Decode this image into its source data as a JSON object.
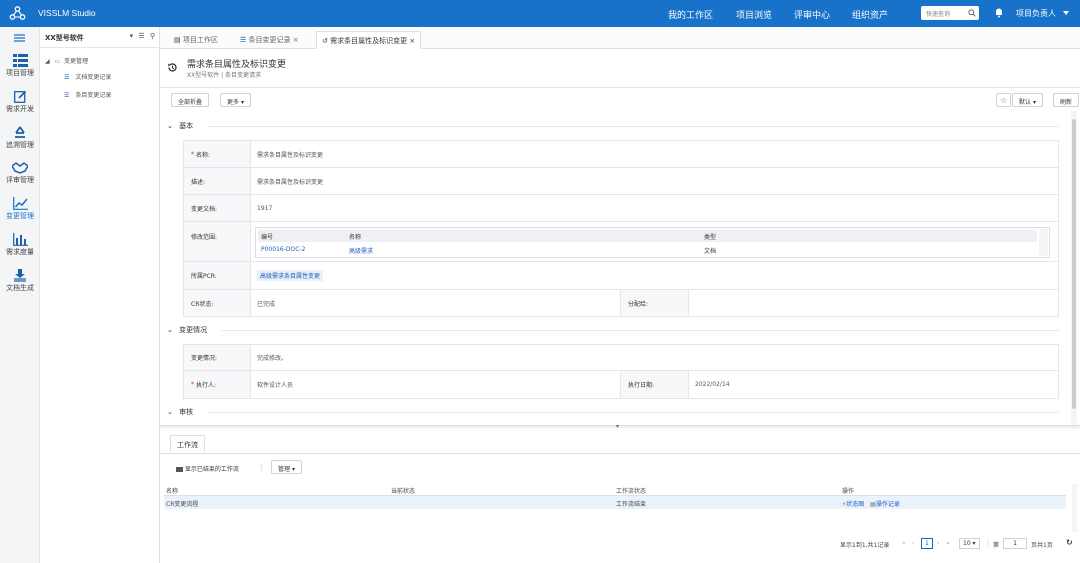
{
  "topbar": {
    "app_title": "VISSLM Studio",
    "nav": [
      "我的工作区",
      "项目浏览",
      "评审中心",
      "组织资产"
    ],
    "search_placeholder": "快速查询",
    "user": "项目负责人"
  },
  "leftbar": {
    "items": [
      {
        "label": "项目管理",
        "icon": "grid-list-icon"
      },
      {
        "label": "需求开发",
        "icon": "edit-icon"
      },
      {
        "label": "追溯管理",
        "icon": "recycle-icon"
      },
      {
        "label": "评审管理",
        "icon": "handshake-icon"
      },
      {
        "label": "变更管理",
        "icon": "trend-chart-icon"
      },
      {
        "label": "需求度量",
        "icon": "bar-chart-icon"
      },
      {
        "label": "文档生成",
        "icon": "document-stack-icon"
      }
    ]
  },
  "tree": {
    "title": "XX型号软件",
    "root": "变更管理",
    "children": [
      "文档变更记录",
      "条目变更记录"
    ]
  },
  "tabs": [
    {
      "label": "项目工作区",
      "icon": "document-icon"
    },
    {
      "label": "条目变更记录",
      "icon": "list-icon"
    },
    {
      "label": "需求条目属性及标识变更",
      "icon": "history-icon"
    }
  ],
  "page": {
    "title": "需求条目属性及标识变更",
    "crumb": "XX型号软件 | 条目变更请求"
  },
  "toolbar": {
    "collapse_all": "全部折叠",
    "more": "更多",
    "default": "默认",
    "refresh": "刷新"
  },
  "sections": {
    "basic": "基本",
    "change": "变更情况",
    "review": "审核"
  },
  "form": {
    "name_label": "名称:",
    "name_value": "需求条目属性及标识变更",
    "desc_label": "描述:",
    "desc_value": "需求条目属性及标识变更",
    "doc_label": "变更文档:",
    "doc_value": "1917",
    "scope_label": "修改范围:",
    "scope_headers": [
      "编号",
      "名称",
      "类型"
    ],
    "scope_row": [
      "P00016-DOC-2",
      "高级需求",
      "文档"
    ],
    "pcr_label": "所属PCR:",
    "pcr_value": "高级需求条目属性变更",
    "cr_status_label": "CR状态:",
    "cr_status_value": "已完成",
    "assign_label": "分配给:",
    "change_label": "变更情况:",
    "change_value": "完成修改。",
    "executor_label": "执行人:",
    "executor_value": "软件设计人员",
    "exec_date_label": "执行日期:",
    "exec_date_value": "2022/02/14"
  },
  "workflow": {
    "tab": "工作流",
    "show_finished": "显示已结束的工作流",
    "manage": "管理",
    "headers": [
      "名称",
      "当前状态",
      "工作流状态",
      "操作"
    ],
    "row": {
      "name": "CR变更流程",
      "current": "",
      "status": "工作流结束",
      "op_state": "状态图",
      "op_log": "操作记录"
    },
    "pager": {
      "summary": "显示1到1,共1记录",
      "page": "1",
      "page_size": "10",
      "goto_prefix": "第",
      "goto_value": "1",
      "total_pages": "页共1页"
    }
  }
}
